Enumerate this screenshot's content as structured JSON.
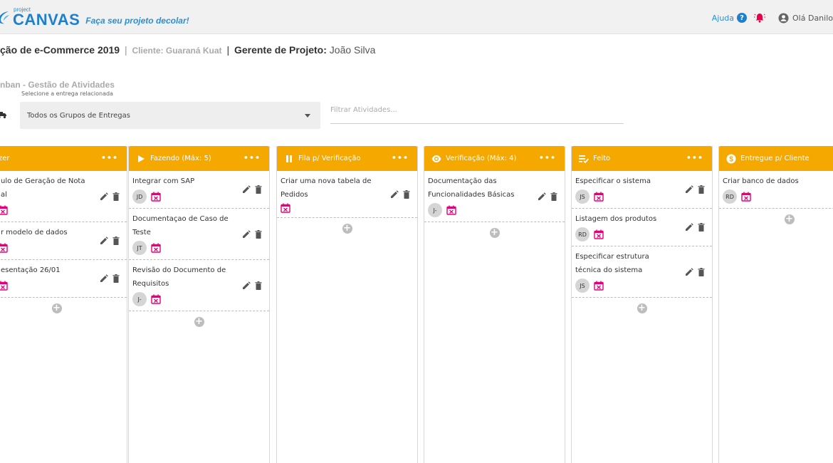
{
  "header": {
    "logo_small": "project",
    "logo_big": "CANVAS",
    "tagline": "Faça seu projeto decolar!",
    "help_label": "Ajuda",
    "help_icon": "help-circle-icon",
    "bell_icon": "bell-alert-icon",
    "user_icon": "user-circle-icon",
    "user_greeting": "Olá Danilo",
    "colors": {
      "brand": "#1f7fcf",
      "topbar": "#f1f1f1",
      "bell": "#e6004c"
    }
  },
  "project": {
    "name": "ção de e-Commerce 2019",
    "separator": "|",
    "client": "Cliente: Guaraná Kuat",
    "manager_label": "Gerente de Projeto:",
    "manager": "João Silva"
  },
  "kanban": {
    "title": "nban - Gestão de Atividades",
    "select_hint": "Selecione a entrega relacionada",
    "group_select": "Todos os Grupos de Entregas",
    "filter_placeholder": "Filtrar Atividades...",
    "colors": {
      "column_header": "#f5a800",
      "calendar": "#e6007a",
      "avatar": "#d5d5d5"
    }
  },
  "columns": [
    {
      "title": "Fazer",
      "icon": "list-icon",
      "more": "•••",
      "cards": [
        {
          "text": "ulo de Geração de Nota al",
          "avatar": ""
        },
        {
          "text": "r modelo de dados",
          "avatar": ""
        },
        {
          "text": "esentação 26/01",
          "avatar": ""
        }
      ]
    },
    {
      "title": "Fazendo (Máx: 5)",
      "icon": "play-icon",
      "more": "•••",
      "cards": [
        {
          "text": "Integrar com SAP",
          "avatar": "JD"
        },
        {
          "text": "Documentaçao de Caso de Teste",
          "avatar": "JT"
        },
        {
          "text": "Revisão do Documento de Requisitos",
          "avatar": "J-"
        }
      ]
    },
    {
      "title": "Fila p/ Verificação",
      "icon": "pause-icon",
      "more": "•••",
      "cards": [
        {
          "text": "Criar uma nova tabela de Pedidos",
          "avatar": ""
        }
      ]
    },
    {
      "title": "Verificação (Máx: 4)",
      "icon": "eye-icon",
      "more": "•••",
      "cards": [
        {
          "text": "Documentação das Funcionalidades Básicas",
          "avatar": "J-"
        }
      ]
    },
    {
      "title": "Feito",
      "icon": "checklist-icon",
      "more": "•••",
      "cards": [
        {
          "text": "Especificar o sistema",
          "avatar": "JS"
        },
        {
          "text": "Listagem dos produtos",
          "avatar": "RD"
        },
        {
          "text": "Especificar estrutura técnica do sistema",
          "avatar": "JS"
        }
      ]
    },
    {
      "title": "Entregue p/ Cliente",
      "icon": "dollar-icon",
      "more": "",
      "cards": [
        {
          "text": "Criar banco de dados",
          "avatar": "RD"
        }
      ]
    }
  ]
}
